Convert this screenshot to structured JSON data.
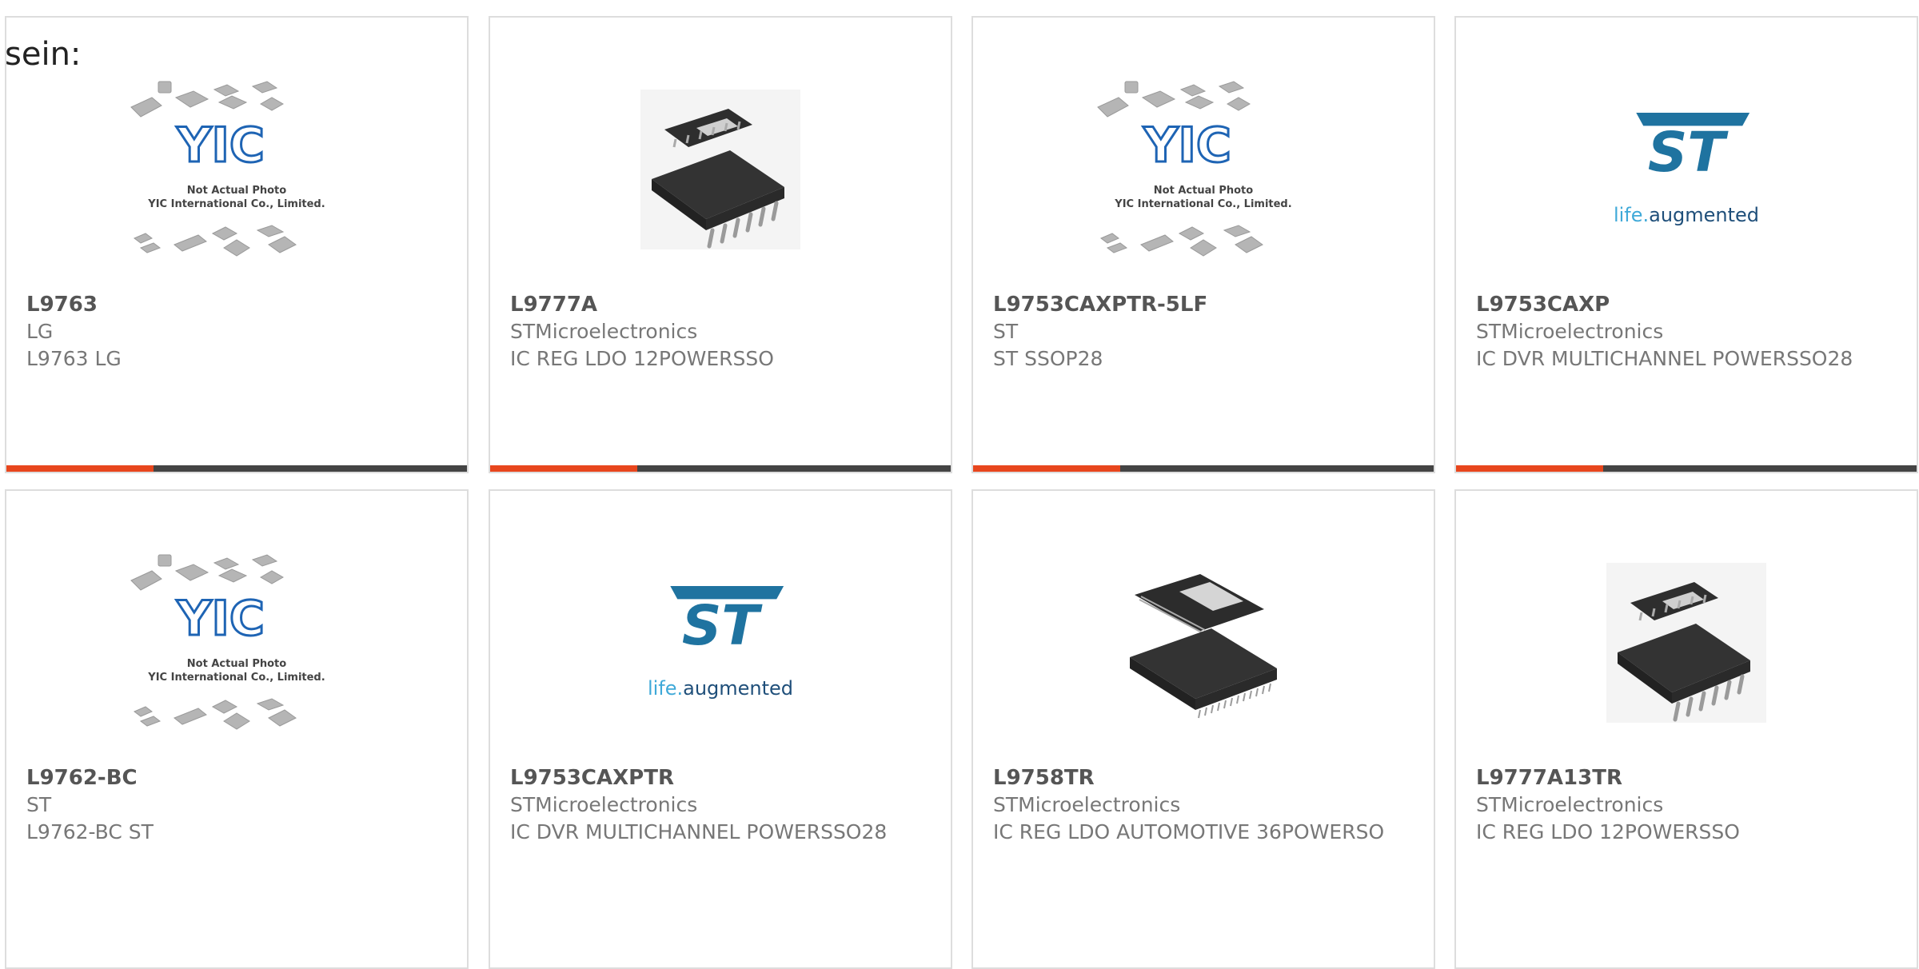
{
  "intro_text": "sein:",
  "placeholder": {
    "caption_line1": "Not Actual Photo",
    "caption_line2": "YIC International Co., Limited."
  },
  "st_logo": {
    "mark": "ST",
    "tagline_prefix": "life.",
    "tagline_suffix": "augmented"
  },
  "colors": {
    "accent": "#e8461d",
    "bar_dark": "#444444",
    "st_blue": "#1f73a0",
    "text": "#777777"
  },
  "products": [
    {
      "part_number": "L9763",
      "manufacturer": "LG",
      "description": "L9763 LG",
      "image": "placeholder-collage"
    },
    {
      "part_number": "L9777A",
      "manufacturer": "STMicroelectronics",
      "description": "IC REG LDO 12POWERSSO",
      "image": "chip-photo-powersso12"
    },
    {
      "part_number": "L9753CAXPTR-5LF",
      "manufacturer": "ST",
      "description": "ST SSOP28",
      "image": "placeholder-collage"
    },
    {
      "part_number": "L9753CAXP",
      "manufacturer": "STMicroelectronics",
      "description": "IC DVR MULTICHANNEL POWERSSO28",
      "image": "st-logo"
    },
    {
      "part_number": "L9762-BC",
      "manufacturer": "ST",
      "description": "L9762-BC ST",
      "image": "placeholder-collage"
    },
    {
      "part_number": "L9753CAXPTR",
      "manufacturer": "STMicroelectronics",
      "description": "IC DVR MULTICHANNEL POWERSSO28",
      "image": "st-logo"
    },
    {
      "part_number": "L9758TR",
      "manufacturer": "STMicroelectronics",
      "description": "IC REG LDO AUTOMOTIVE 36POWERSO",
      "image": "chip-photo-powerso36"
    },
    {
      "part_number": "L9777A13TR",
      "manufacturer": "STMicroelectronics",
      "description": "IC REG LDO 12POWERSSO",
      "image": "chip-photo-powersso12"
    }
  ]
}
